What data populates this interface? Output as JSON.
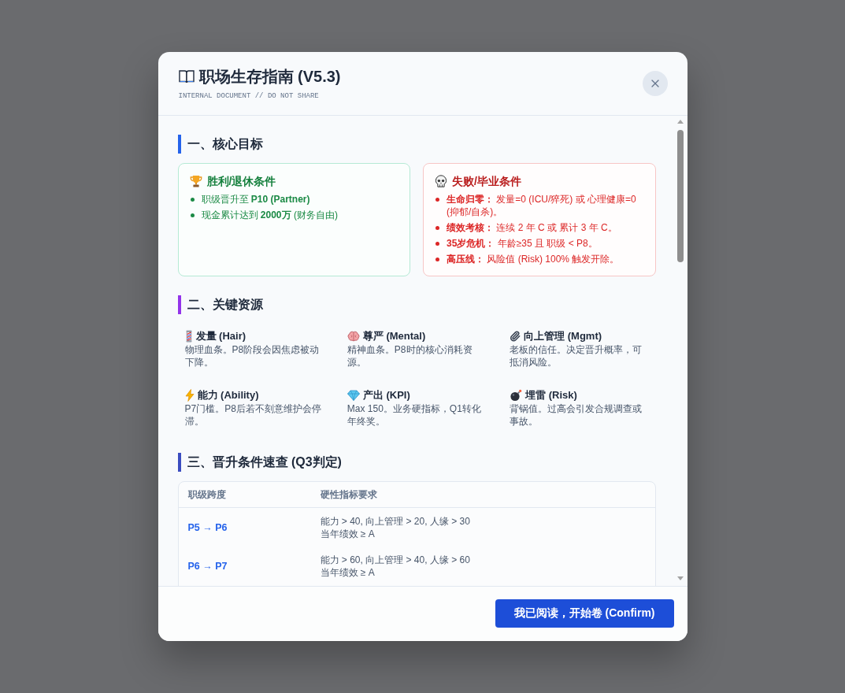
{
  "dialog": {
    "title": "职场生存指南 (V5.3)",
    "subtitle": "INTERNAL DOCUMENT // DO NOT SHARE"
  },
  "sections": [
    {
      "kind": "cards",
      "heading": "一、核心目标",
      "color": "#2563eb",
      "cards": [
        {
          "kind": "win",
          "title": "胜利/退休条件",
          "items": [
            "职级晋升至 **P10 (Partner)**",
            "现金累计达到 **2000万** (财务自由)"
          ]
        },
        {
          "kind": "fail",
          "title": "失败/毕业条件",
          "items": [
            "**生命归零：** 发量=0 (ICU/猝死) 或 心理健康=0 (抑郁/自杀)。",
            "**绩效考核：** 连续 2 年 C 或 累计 3 年 C。",
            "**35岁危机：** 年龄≥35 且 职级 < P8。",
            "**高压线：** 风险值 (Risk) 100% 触发开除。"
          ]
        }
      ]
    },
    {
      "kind": "grid",
      "heading": "二、关键资源",
      "color": "#9333ea",
      "items": [
        {
          "title": "发量 (Hair)",
          "text": "物理血条。P8阶段会因焦虑被动下降。"
        },
        {
          "title": "尊严 (Mental)",
          "text": "精神血条。P8时的核心消耗资源。"
        },
        {
          "title": "向上管理 (Mgmt)",
          "text": "老板的信任。决定晋升概率，可抵消风险。"
        },
        {
          "title": "能力 (Ability)",
          "text": "P7门槛。P8后若不刻意维护会停滞。"
        },
        {
          "title": "产出 (KPI)",
          "text": "Max 150。业务硬指标，Q1转化年终奖。"
        },
        {
          "title": "埋雷 (Risk)",
          "text": "背锅值。过高会引发合规调查或事故。"
        }
      ]
    },
    {
      "kind": "table",
      "heading": "三、晋升条件速查 (Q3判定)",
      "color": "#3b4cc0",
      "columns": [
        "职级跨度",
        "硬性指标要求"
      ],
      "rows": [
        {
          "span": "P5 → P6",
          "requirements": "能力 > 40, 向上管理 > 20, 人缘 > 30\n当年绩效 ≥ A"
        },
        {
          "span": "P6 → P7",
          "requirements": "能力 > 60, 向上管理 > 40, 人缘 > 60\n当年绩效 ≥ A"
        }
      ]
    }
  ],
  "footer": {
    "confirm_button": "我已阅读，开始卷 (Confirm)"
  }
}
